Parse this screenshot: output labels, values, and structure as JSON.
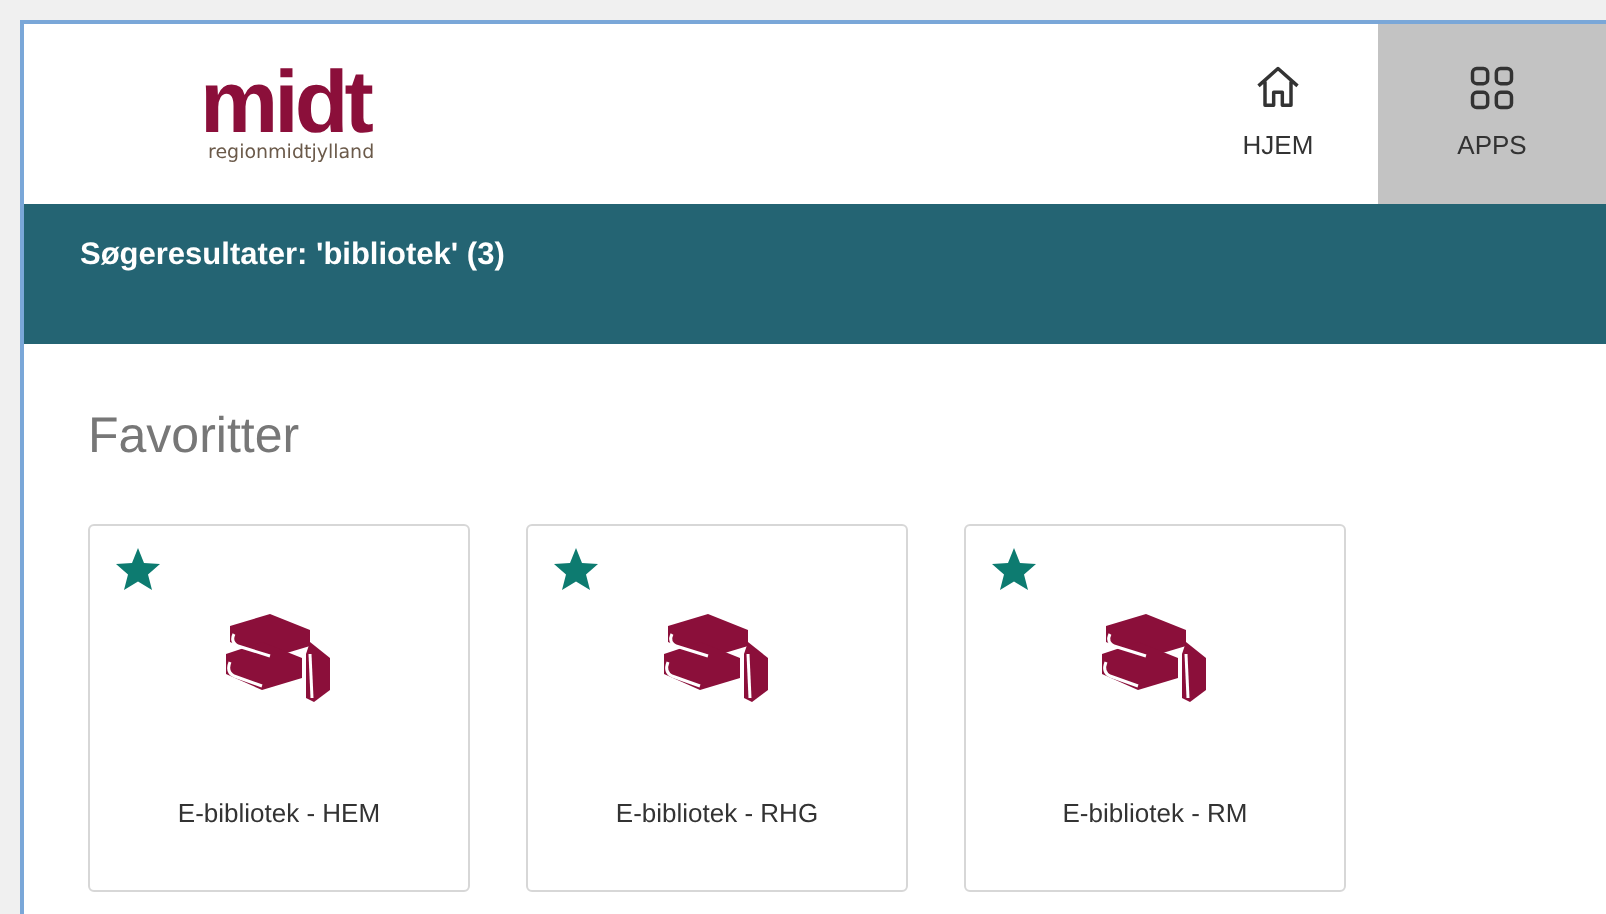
{
  "header": {
    "logo": {
      "word": "midt",
      "tagline": "regionmidtjylland"
    },
    "nav": [
      {
        "label": "HJEM",
        "kind": "home",
        "selected": false
      },
      {
        "label": "APPS",
        "kind": "apps",
        "selected": true
      }
    ]
  },
  "search_bar": {
    "title": "Søgeresultater: 'bibliotek' (3)"
  },
  "section": {
    "title": "Favoritter",
    "apps": [
      {
        "label": "E-bibliotek - HEM",
        "favorite": true
      },
      {
        "label": "E-bibliotek - RHG",
        "favorite": true
      },
      {
        "label": "E-bibliotek - RM",
        "favorite": true
      }
    ]
  }
}
